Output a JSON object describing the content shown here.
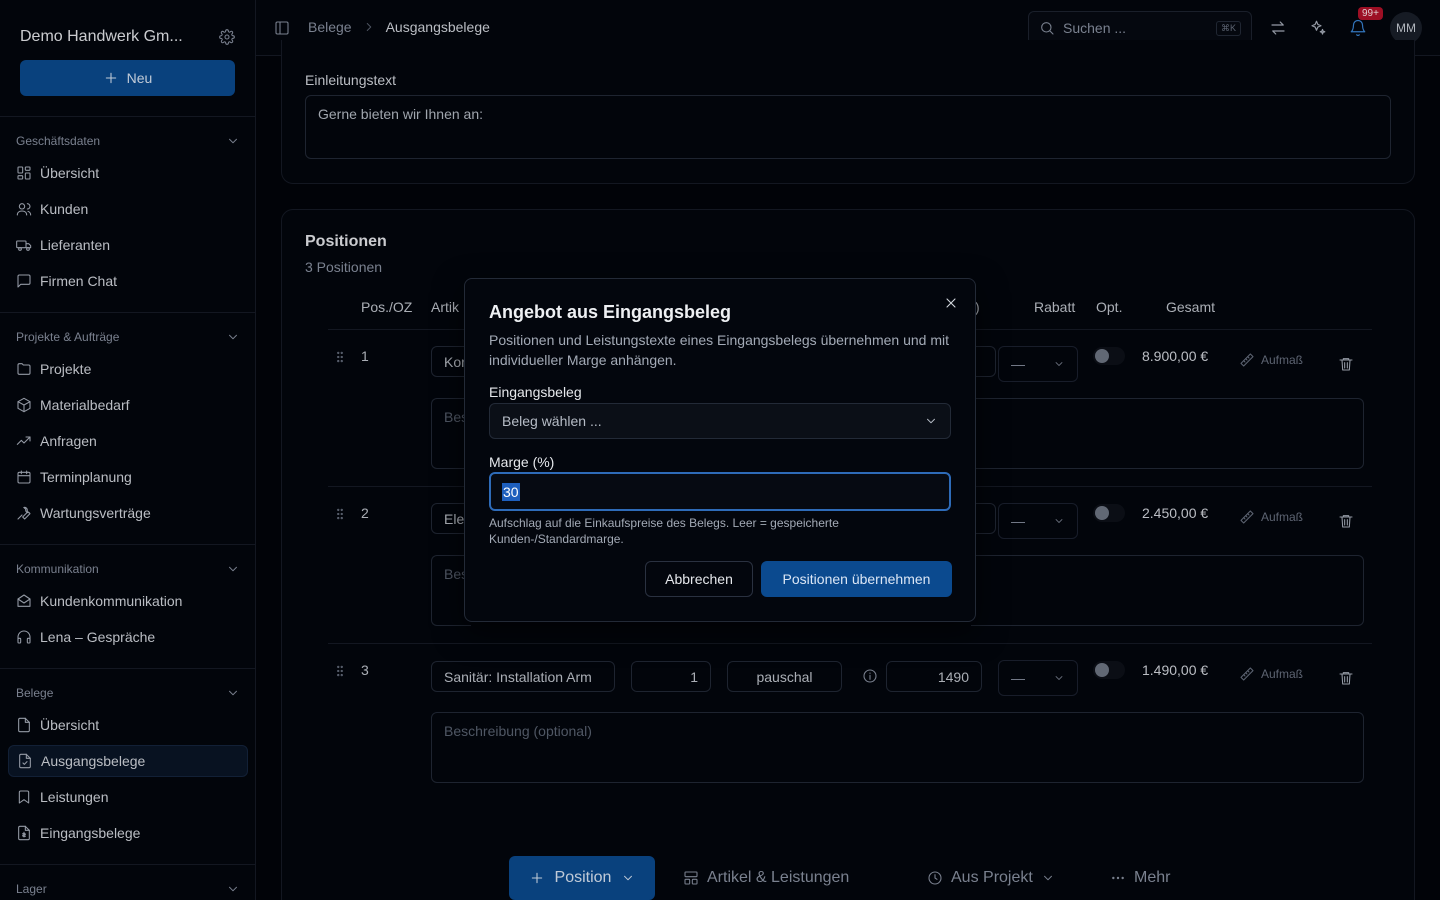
{
  "sidebar": {
    "company": "Demo Handwerk Gm...",
    "new_label": "Neu",
    "groups": [
      {
        "label": "Geschäftsdaten",
        "items": [
          "Übersicht",
          "Kunden",
          "Lieferanten",
          "Firmen Chat"
        ]
      },
      {
        "label": "Projekte & Aufträge",
        "items": [
          "Projekte",
          "Materialbedarf",
          "Anfragen",
          "Terminplanung",
          "Wartungsverträge"
        ]
      },
      {
        "label": "Kommunikation",
        "items": [
          "Kundenkommunikation",
          "Lena – Gespräche"
        ]
      },
      {
        "label": "Belege",
        "items": [
          "Übersicht",
          "Ausgangsbelege",
          "Leistungen",
          "Eingangsbelege"
        ]
      },
      {
        "label": "Lager",
        "items": []
      }
    ],
    "active_item": "Ausgangsbelege"
  },
  "topbar": {
    "breadcrumb": [
      "Belege",
      "Ausgangsbelege"
    ],
    "search_placeholder": "Suchen ...",
    "search_shortcut": "⌘K",
    "notification_count": "99+",
    "avatar_initials": "MM"
  },
  "intro": {
    "label": "Einleitungstext",
    "value": "Gerne bieten wir Ihnen an:"
  },
  "positions": {
    "title": "Positionen",
    "count": "3 Positionen",
    "headers": {
      "pos": "Pos./OZ",
      "article": "Artik",
      "paren": ")",
      "rabatt": "Rabatt",
      "opt": "Opt.",
      "gesamt": "Gesamt"
    },
    "rows": [
      {
        "pos": "1",
        "article": "Kor",
        "description": "Bes",
        "rabatt": "—",
        "total": "8.900,00 €",
        "aufmass": "Aufmaß"
      },
      {
        "pos": "2",
        "article": "Ele",
        "description": "Bes",
        "rabatt": "—",
        "total": "2.450,00 €",
        "aufmass": "Aufmaß"
      },
      {
        "pos": "3",
        "article": "Sanitär: Installation Arm",
        "qty": "1",
        "unit": "pauschal",
        "price": "1490",
        "description": "Beschreibung (optional)",
        "rabatt": "—",
        "total": "1.490,00 €",
        "aufmass": "Aufmaß"
      }
    ]
  },
  "toolbar": {
    "position_label": "Position",
    "articles_label": "Artikel & Leistungen",
    "project_label": "Aus Projekt",
    "more_label": "Mehr"
  },
  "dialog": {
    "title": "Angebot aus Eingangsbeleg",
    "description": "Positionen und Leistungstexte eines Eingangsbelegs übernehmen und mit individueller Marge anhängen.",
    "beleg_label": "Eingangsbeleg",
    "beleg_placeholder": "Beleg wählen ...",
    "marge_label": "Marge (%)",
    "marge_value": "30",
    "hint": "Aufschlag auf die Einkaufspreise des Belegs. Leer = gespeicherte Kunden-/Standardmarge.",
    "cancel_label": "Abbrechen",
    "confirm_label": "Positionen übernehmen"
  }
}
